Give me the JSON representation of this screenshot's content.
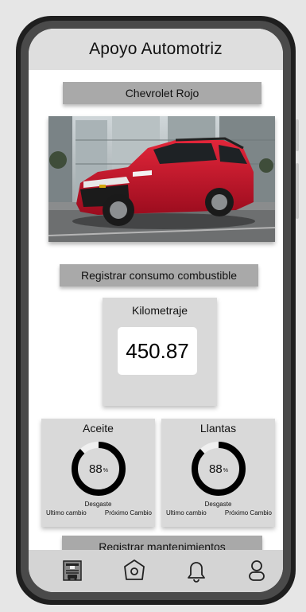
{
  "app": {
    "title": "Apoyo Automotriz"
  },
  "vehicle": {
    "name": "Chevrolet Rojo"
  },
  "actions": {
    "fuel_button": "Registrar consumo combustible",
    "maintenance_button": "Registrar mantenimientos"
  },
  "mileage": {
    "label": "Kilometraje",
    "value": "450.87"
  },
  "stats": {
    "oil": {
      "label": "Aceite",
      "value": "88",
      "unit": "%",
      "fraction": 0.88,
      "wear_label": "Desgaste",
      "last_change": "Ultimo cambio",
      "next_change": "Próximo Cambio"
    },
    "tires": {
      "label": "Llantas",
      "value": "88",
      "unit": "%",
      "fraction": 0.88,
      "wear_label": "Desgaste",
      "last_change": "Ultimo cambio",
      "next_change": "Próximo Cambio"
    }
  },
  "nav": {
    "items": [
      {
        "icon": "garage-icon"
      },
      {
        "icon": "home-icon"
      },
      {
        "icon": "bell-icon"
      },
      {
        "icon": "user-icon"
      }
    ]
  },
  "colors": {
    "header_bg": "#dedede",
    "button_bg": "#a9a9a9",
    "card_bg": "#d9d9d9",
    "car_red": "#c8102e"
  }
}
